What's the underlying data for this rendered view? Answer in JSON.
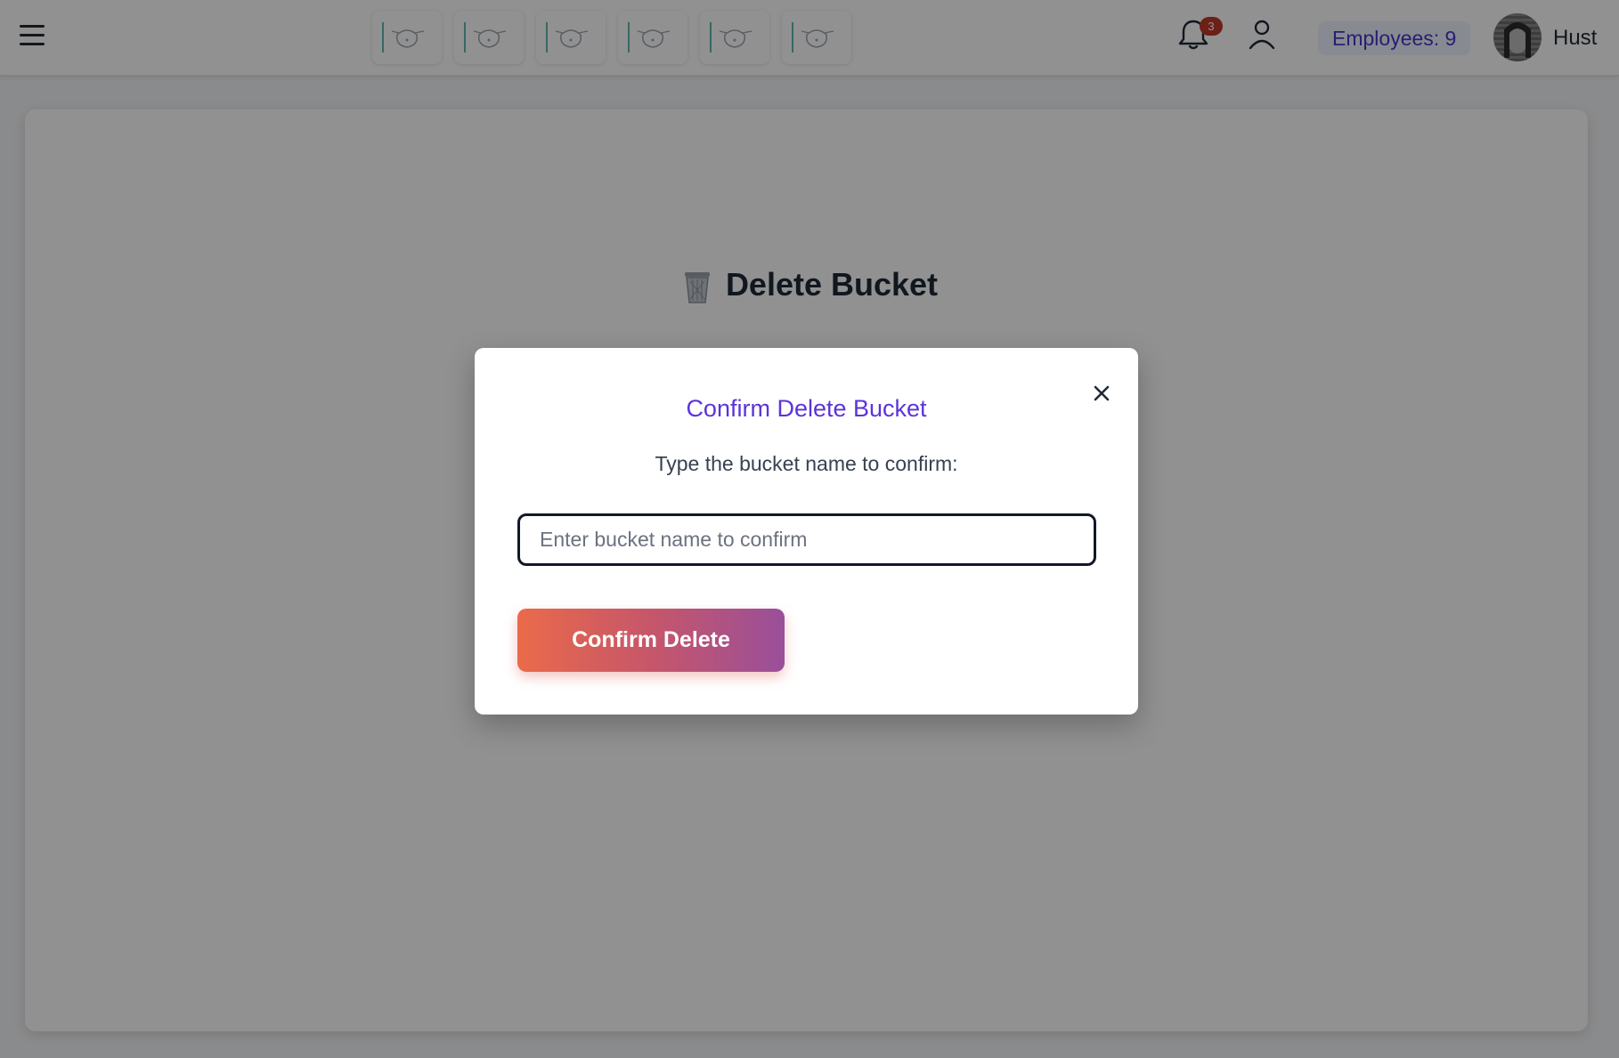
{
  "topbar": {
    "menu_icon": "hamburger-menu-icon",
    "logo_icon": "eye-glasses-logo-icon",
    "logo_count": 6,
    "notifications": {
      "icon": "bell-icon",
      "count": "3"
    },
    "profile_icon": "user-icon",
    "employees_label": "Employees: 9",
    "user": {
      "name": "Hust",
      "avatar_icon": "user-avatar"
    }
  },
  "page": {
    "heading": "Delete Bucket",
    "heading_icon": "trash-can-icon"
  },
  "modal": {
    "title": "Confirm Delete Bucket",
    "instruction": "Type the bucket name to confirm:",
    "input": {
      "value": "",
      "placeholder": "Enter bucket name to confirm"
    },
    "confirm_label": "Confirm Delete",
    "close_icon": "close-icon"
  },
  "colors": {
    "modal_title": "#5b34d8",
    "button_gradient_start": "#ea6a4a",
    "button_gradient_end": "#9a4f9a",
    "badge": "#c0392b",
    "employees_text": "#4338ca"
  }
}
